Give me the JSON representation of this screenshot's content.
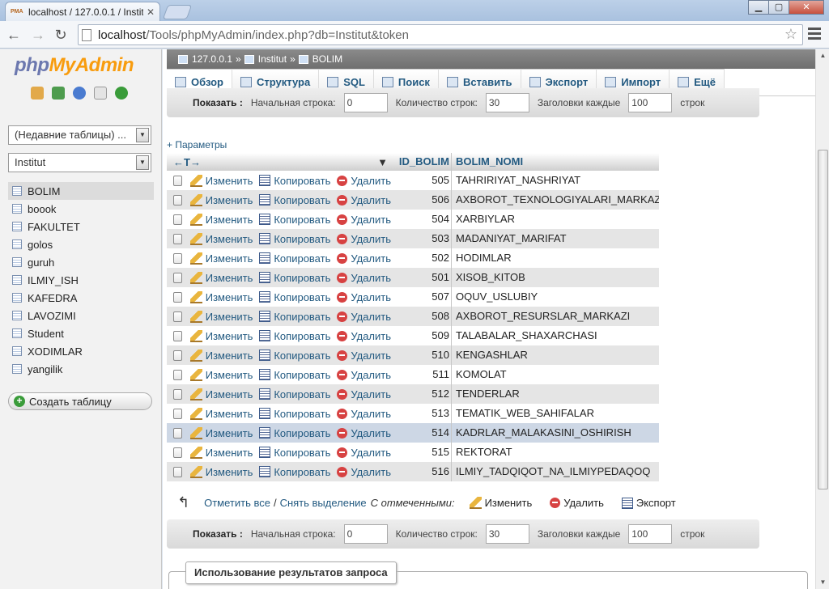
{
  "browser": {
    "tab_title": "localhost / 127.0.0.1 / Instit",
    "tab_favicon": "PMA",
    "url_host": "localhost",
    "url_path": "/Tools/phpMyAdmin/index.php?db=Institut&token"
  },
  "sidebar": {
    "logo_php": "php",
    "logo_my": "My",
    "logo_admin": "Admin",
    "recent_tables": "(Недавние таблицы) ...",
    "database": "Institut",
    "tables": [
      "BOLIM",
      "boook",
      "FAKULTET",
      "golos",
      "guruh",
      "ILMIY_ISH",
      "KAFEDRA",
      "LAVOZIMI",
      "Student",
      "XODIMLAR",
      "yangilik"
    ],
    "create_table": "Создать таблицу"
  },
  "breadcrumb": {
    "server": "127.0.0.1",
    "sep": "»",
    "db": "Institut",
    "table": "BOLIM"
  },
  "tabs": [
    "Обзор",
    "Структура",
    "SQL",
    "Поиск",
    "Вставить",
    "Экспорт",
    "Импорт",
    "Ещё"
  ],
  "navigation": {
    "show_label": "Показать :",
    "start_row_label": "Начальная строка:",
    "start_row_value": "0",
    "row_count_label": "Количество строк:",
    "row_count_value": "30",
    "headers_every_label": "Заголовки каждые",
    "headers_every_value": "100",
    "rows_label": "строк"
  },
  "params_link": "+ Параметры",
  "grid": {
    "sort_arrows": "←T→",
    "col_id": "ID_BOLIM",
    "col_name": "BOLIM_NOMI",
    "edit_label": "Изменить",
    "copy_label": "Копировать",
    "delete_label": "Удалить",
    "rows": [
      {
        "id": "505",
        "name": "TAHRIRIYAT_NASHRIYAT"
      },
      {
        "id": "506",
        "name": "AXBOROT_TEXNOLOGIYALARI_MARKAZ"
      },
      {
        "id": "504",
        "name": "XARBIYLAR"
      },
      {
        "id": "503",
        "name": "MADANIYAT_MARIFAT"
      },
      {
        "id": "502",
        "name": "HODIMLAR"
      },
      {
        "id": "501",
        "name": "XISOB_KITOB"
      },
      {
        "id": "507",
        "name": "OQUV_USLUBIY"
      },
      {
        "id": "508",
        "name": "AXBOROT_RESURSLAR_MARKAZI"
      },
      {
        "id": "509",
        "name": "TALABALAR_SHAXARCHASI"
      },
      {
        "id": "510",
        "name": "KENGASHLAR"
      },
      {
        "id": "511",
        "name": "KOMOLAT"
      },
      {
        "id": "512",
        "name": "TENDERLAR"
      },
      {
        "id": "513",
        "name": "TEMATIK_WEB_SAHIFALAR"
      },
      {
        "id": "514",
        "name": "KADRLAR_MALAKASINI_OSHIRISH"
      },
      {
        "id": "515",
        "name": "REKTORAT"
      },
      {
        "id": "516",
        "name": "ILMIY_TADQIQOT_NA_ILMIYPEDAQOQ"
      }
    ]
  },
  "bulk": {
    "check_all": "Отметить все",
    "slash": "/",
    "uncheck_all": "Снять выделение",
    "with_selected": "С отмеченными:",
    "edit": "Изменить",
    "delete": "Удалить",
    "export": "Экспорт"
  },
  "query_results_legend": "Использование результатов запроса"
}
